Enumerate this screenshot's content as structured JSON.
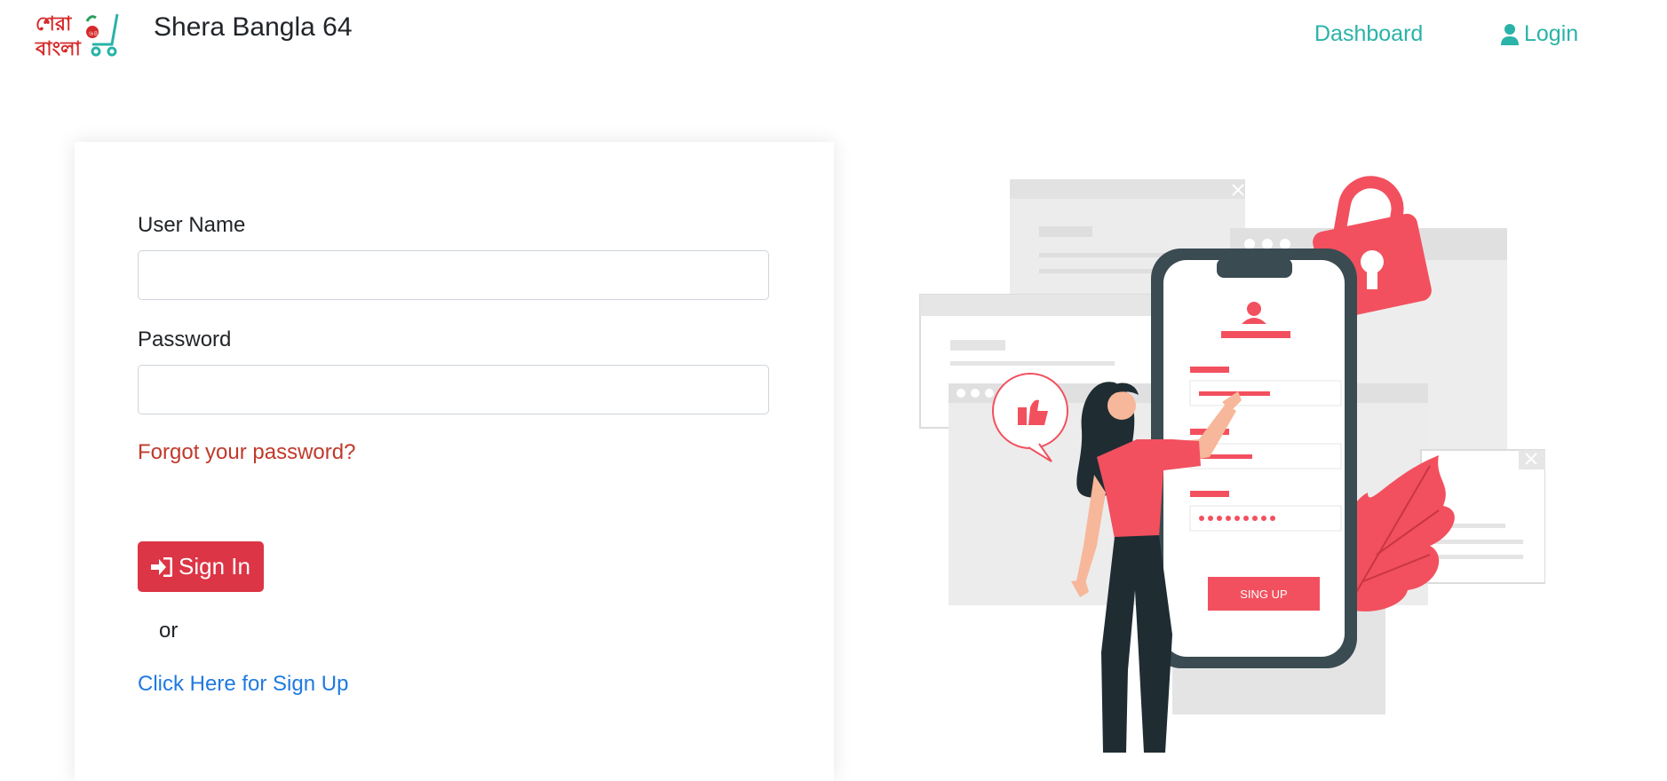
{
  "header": {
    "logo_alt": "শেরা বাংলা ৬৪",
    "brand": "Shera Bangla 64",
    "nav": {
      "dashboard": "Dashboard",
      "login": "Login"
    }
  },
  "login_form": {
    "username_label": "User Name",
    "username_value": "",
    "password_label": "Password",
    "password_value": "",
    "forgot_link": "Forgot your password?",
    "signin_button": "Sign In",
    "or_text": "or",
    "signup_link": "Click Here for Sign Up"
  },
  "illustration": {
    "signup_button_text": "SING UP"
  },
  "colors": {
    "accent": "#2ab3a8",
    "danger": "#dc3545",
    "link": "#1f7ae0",
    "illustration_red": "#f2505e",
    "illustration_dark": "#3a4b52"
  }
}
